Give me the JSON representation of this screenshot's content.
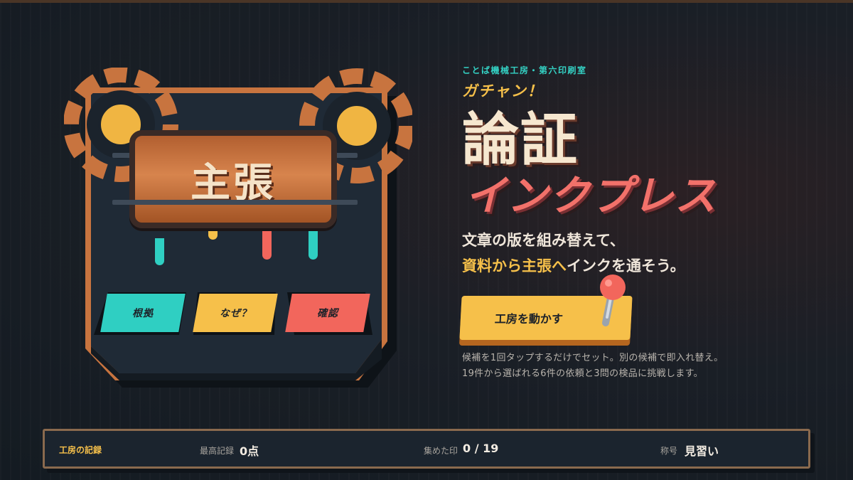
{
  "machine": {
    "sign_label": "主張",
    "buttons": [
      {
        "label": "根拠",
        "color": "#2fcfc2"
      },
      {
        "label": "なぜ？",
        "color": "#f6c04a"
      },
      {
        "label": "確認",
        "color": "#f2665c"
      }
    ]
  },
  "hero": {
    "kicker": "ことば機械工房・第六印刷室",
    "exclaim": "ガチャン！",
    "title_main": "論証",
    "title_sub": "インクプレス",
    "tagline_1": "文章の版を組み替えて、",
    "tagline_2_highlight": "資料から主張へ",
    "tagline_2_rest": "インクを通そう。",
    "start_label": "工房を動かす",
    "note_1": "候補を1回タップするだけでセット。別の候補で即入れ替え。",
    "note_2": "19件から選ばれる6件の依頼と3問の検品に挑戦します。"
  },
  "stats": {
    "section_label": "工房の記録",
    "best_key": "最高記録",
    "best_value": "0点",
    "stamps_key": "集めた印",
    "stamps_value": "0 / 19",
    "title_key": "称号",
    "title_value": "見習い"
  },
  "colors": {
    "accent_yellow": "#f6c04a",
    "accent_teal": "#34d1c4",
    "accent_red": "#f2716a",
    "copper": "#c8743f"
  }
}
